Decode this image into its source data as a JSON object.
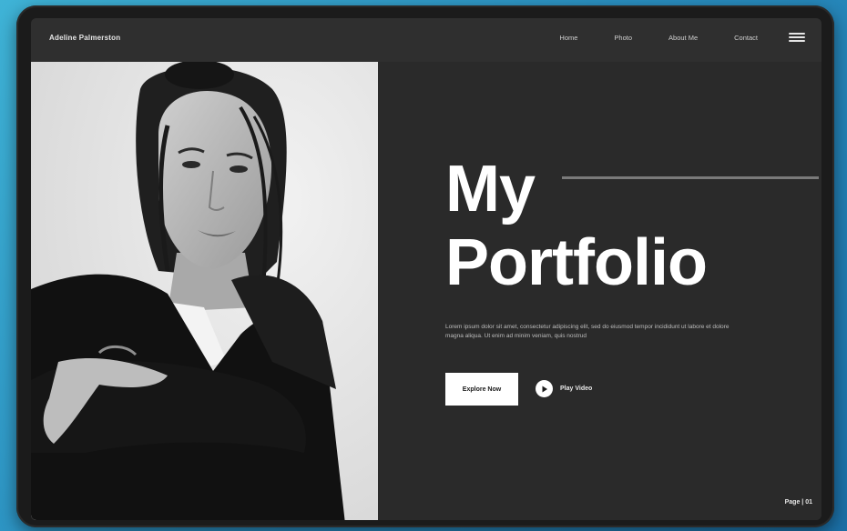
{
  "nav": {
    "brand": "Adeline Palmerston",
    "links": [
      "Home",
      "Photo",
      "About Me",
      "Contact"
    ],
    "menu_icon": "hamburger-menu-icon"
  },
  "hero": {
    "title_line1": "My",
    "title_line2": "Portfolio",
    "description": "Lorem ipsum dolor sit amet, consectetur adipiscing elit, sed do eiusmod tempor incididunt ut labore et dolore magna aliqua. Ut enim ad minim veniam, quis nostrud",
    "explore_label": "Explore Now",
    "play_label": "Play Video",
    "play_icon": "play-icon"
  },
  "photo": {
    "subject": "portrait-photo"
  },
  "pager": {
    "label": "Page | 01"
  },
  "colors": {
    "background": "#2a2a2a",
    "accent": "#ffffff",
    "frame": "#1b1b1b",
    "backdrop": "#2a8fc0"
  }
}
